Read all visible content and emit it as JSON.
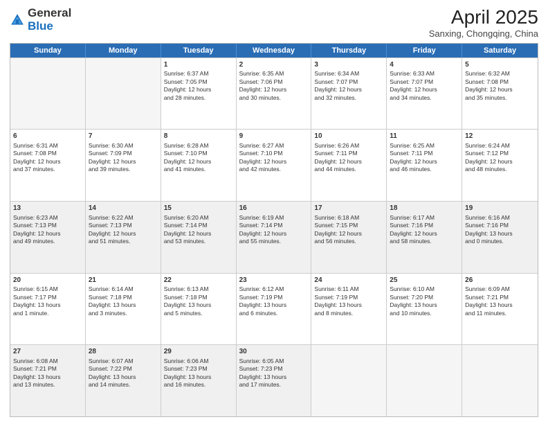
{
  "header": {
    "logo_general": "General",
    "logo_blue": "Blue",
    "month_title": "April 2025",
    "subtitle": "Sanxing, Chongqing, China"
  },
  "weekdays": [
    "Sunday",
    "Monday",
    "Tuesday",
    "Wednesday",
    "Thursday",
    "Friday",
    "Saturday"
  ],
  "rows": [
    [
      {
        "day": "",
        "lines": [],
        "empty": true
      },
      {
        "day": "",
        "lines": [],
        "empty": true
      },
      {
        "day": "1",
        "lines": [
          "Sunrise: 6:37 AM",
          "Sunset: 7:05 PM",
          "Daylight: 12 hours",
          "and 28 minutes."
        ]
      },
      {
        "day": "2",
        "lines": [
          "Sunrise: 6:35 AM",
          "Sunset: 7:06 PM",
          "Daylight: 12 hours",
          "and 30 minutes."
        ]
      },
      {
        "day": "3",
        "lines": [
          "Sunrise: 6:34 AM",
          "Sunset: 7:07 PM",
          "Daylight: 12 hours",
          "and 32 minutes."
        ]
      },
      {
        "day": "4",
        "lines": [
          "Sunrise: 6:33 AM",
          "Sunset: 7:07 PM",
          "Daylight: 12 hours",
          "and 34 minutes."
        ]
      },
      {
        "day": "5",
        "lines": [
          "Sunrise: 6:32 AM",
          "Sunset: 7:08 PM",
          "Daylight: 12 hours",
          "and 35 minutes."
        ]
      }
    ],
    [
      {
        "day": "6",
        "lines": [
          "Sunrise: 6:31 AM",
          "Sunset: 7:08 PM",
          "Daylight: 12 hours",
          "and 37 minutes."
        ]
      },
      {
        "day": "7",
        "lines": [
          "Sunrise: 6:30 AM",
          "Sunset: 7:09 PM",
          "Daylight: 12 hours",
          "and 39 minutes."
        ]
      },
      {
        "day": "8",
        "lines": [
          "Sunrise: 6:28 AM",
          "Sunset: 7:10 PM",
          "Daylight: 12 hours",
          "and 41 minutes."
        ]
      },
      {
        "day": "9",
        "lines": [
          "Sunrise: 6:27 AM",
          "Sunset: 7:10 PM",
          "Daylight: 12 hours",
          "and 42 minutes."
        ]
      },
      {
        "day": "10",
        "lines": [
          "Sunrise: 6:26 AM",
          "Sunset: 7:11 PM",
          "Daylight: 12 hours",
          "and 44 minutes."
        ]
      },
      {
        "day": "11",
        "lines": [
          "Sunrise: 6:25 AM",
          "Sunset: 7:11 PM",
          "Daylight: 12 hours",
          "and 46 minutes."
        ]
      },
      {
        "day": "12",
        "lines": [
          "Sunrise: 6:24 AM",
          "Sunset: 7:12 PM",
          "Daylight: 12 hours",
          "and 48 minutes."
        ]
      }
    ],
    [
      {
        "day": "13",
        "lines": [
          "Sunrise: 6:23 AM",
          "Sunset: 7:13 PM",
          "Daylight: 12 hours",
          "and 49 minutes."
        ],
        "shaded": true
      },
      {
        "day": "14",
        "lines": [
          "Sunrise: 6:22 AM",
          "Sunset: 7:13 PM",
          "Daylight: 12 hours",
          "and 51 minutes."
        ],
        "shaded": true
      },
      {
        "day": "15",
        "lines": [
          "Sunrise: 6:20 AM",
          "Sunset: 7:14 PM",
          "Daylight: 12 hours",
          "and 53 minutes."
        ],
        "shaded": true
      },
      {
        "day": "16",
        "lines": [
          "Sunrise: 6:19 AM",
          "Sunset: 7:14 PM",
          "Daylight: 12 hours",
          "and 55 minutes."
        ],
        "shaded": true
      },
      {
        "day": "17",
        "lines": [
          "Sunrise: 6:18 AM",
          "Sunset: 7:15 PM",
          "Daylight: 12 hours",
          "and 56 minutes."
        ],
        "shaded": true
      },
      {
        "day": "18",
        "lines": [
          "Sunrise: 6:17 AM",
          "Sunset: 7:16 PM",
          "Daylight: 12 hours",
          "and 58 minutes."
        ],
        "shaded": true
      },
      {
        "day": "19",
        "lines": [
          "Sunrise: 6:16 AM",
          "Sunset: 7:16 PM",
          "Daylight: 13 hours",
          "and 0 minutes."
        ],
        "shaded": true
      }
    ],
    [
      {
        "day": "20",
        "lines": [
          "Sunrise: 6:15 AM",
          "Sunset: 7:17 PM",
          "Daylight: 13 hours",
          "and 1 minute."
        ]
      },
      {
        "day": "21",
        "lines": [
          "Sunrise: 6:14 AM",
          "Sunset: 7:18 PM",
          "Daylight: 13 hours",
          "and 3 minutes."
        ]
      },
      {
        "day": "22",
        "lines": [
          "Sunrise: 6:13 AM",
          "Sunset: 7:18 PM",
          "Daylight: 13 hours",
          "and 5 minutes."
        ]
      },
      {
        "day": "23",
        "lines": [
          "Sunrise: 6:12 AM",
          "Sunset: 7:19 PM",
          "Daylight: 13 hours",
          "and 6 minutes."
        ]
      },
      {
        "day": "24",
        "lines": [
          "Sunrise: 6:11 AM",
          "Sunset: 7:19 PM",
          "Daylight: 13 hours",
          "and 8 minutes."
        ]
      },
      {
        "day": "25",
        "lines": [
          "Sunrise: 6:10 AM",
          "Sunset: 7:20 PM",
          "Daylight: 13 hours",
          "and 10 minutes."
        ]
      },
      {
        "day": "26",
        "lines": [
          "Sunrise: 6:09 AM",
          "Sunset: 7:21 PM",
          "Daylight: 13 hours",
          "and 11 minutes."
        ]
      }
    ],
    [
      {
        "day": "27",
        "lines": [
          "Sunrise: 6:08 AM",
          "Sunset: 7:21 PM",
          "Daylight: 13 hours",
          "and 13 minutes."
        ],
        "shaded": true
      },
      {
        "day": "28",
        "lines": [
          "Sunrise: 6:07 AM",
          "Sunset: 7:22 PM",
          "Daylight: 13 hours",
          "and 14 minutes."
        ],
        "shaded": true
      },
      {
        "day": "29",
        "lines": [
          "Sunrise: 6:06 AM",
          "Sunset: 7:23 PM",
          "Daylight: 13 hours",
          "and 16 minutes."
        ],
        "shaded": true
      },
      {
        "day": "30",
        "lines": [
          "Sunrise: 6:05 AM",
          "Sunset: 7:23 PM",
          "Daylight: 13 hours",
          "and 17 minutes."
        ],
        "shaded": true
      },
      {
        "day": "",
        "lines": [],
        "empty": true,
        "shaded": true
      },
      {
        "day": "",
        "lines": [],
        "empty": true,
        "shaded": true
      },
      {
        "day": "",
        "lines": [],
        "empty": true,
        "shaded": true
      }
    ]
  ]
}
